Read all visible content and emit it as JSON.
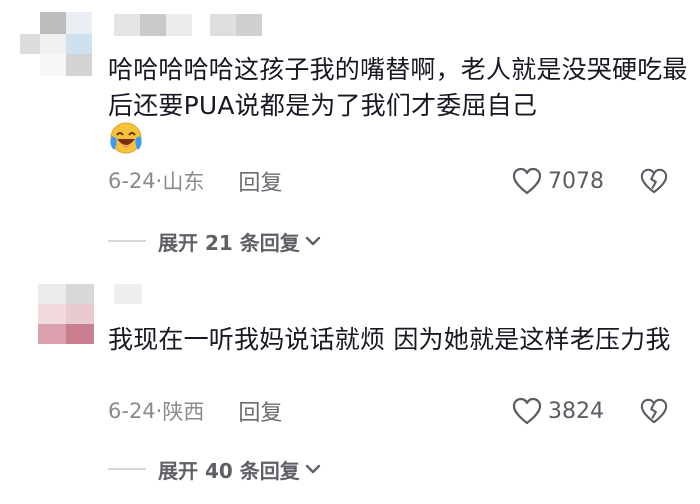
{
  "comments": [
    {
      "text": "哈哈哈哈哈这孩子我的嘴替啊，老人就是没哭硬吃最后还要PUA说都是为了我们才委屈自己",
      "has_emoji": true,
      "emoji_icon": "laughing-crying-emoji-icon",
      "date": "6-24",
      "separator": "·",
      "location": "山东",
      "reply_label": "回复",
      "like_count": "7078",
      "expand_label": "展开 21 条回复"
    },
    {
      "text": "我现在一听我妈说话就烦 因为她就是这样老压力我",
      "has_emoji": false,
      "date": "6-24",
      "separator": "·",
      "location": "陕西",
      "reply_label": "回复",
      "like_count": "3824",
      "expand_label": "展开 40 条回复"
    }
  ],
  "icons": {
    "like": "heart-outline-icon",
    "dislike": "broken-heart-outline-icon",
    "expand": "chevron-down-icon"
  },
  "colors": {
    "text": "#161823",
    "meta": "#8a8b91",
    "emoji_yellow": "#f7c23b",
    "emoji_blue": "#3a9df2"
  }
}
